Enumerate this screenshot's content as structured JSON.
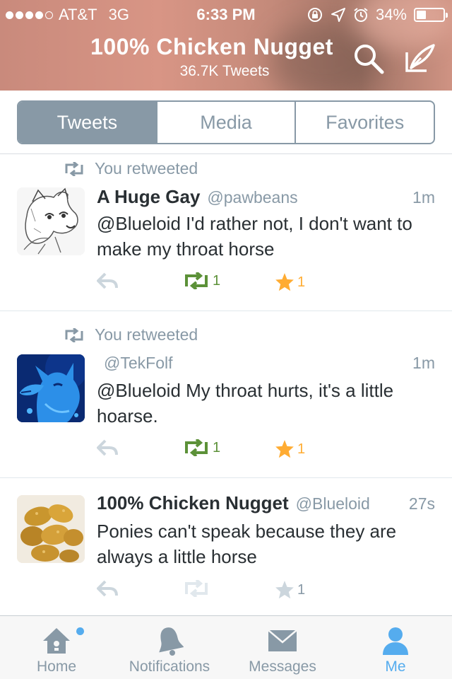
{
  "status_bar": {
    "carrier": "AT&T",
    "network": "3G",
    "time": "6:33 PM",
    "battery": "34%",
    "battery_level": 0.34
  },
  "header": {
    "title": "100% Chicken Nugget",
    "subtitle": "36.7K Tweets"
  },
  "tabs": [
    {
      "label": "Tweets",
      "active": true
    },
    {
      "label": "Media",
      "active": false
    },
    {
      "label": "Favorites",
      "active": false
    }
  ],
  "tweets": [
    {
      "retweet_label": "You retweeted",
      "name": "A Huge Gay",
      "handle": "@pawbeans",
      "time": "1m",
      "text": "@Blueloid I'd rather not, I don't want to make my throat horse",
      "retweets": "1",
      "favorites": "1"
    },
    {
      "retweet_label": "You retweeted",
      "name": "",
      "handle": "@TekFolf",
      "time": "1m",
      "text": "@Blueloid My throat hurts, it's a little hoarse.",
      "retweets": "1",
      "favorites": "1"
    },
    {
      "name": "100% Chicken Nugget",
      "handle": "@Blueloid",
      "time": "27s",
      "text": "Ponies can't speak because they are always a little horse",
      "retweets": "",
      "favorites": "1"
    }
  ],
  "tabbar": [
    {
      "label": "Home",
      "icon": "home-icon"
    },
    {
      "label": "Notifications",
      "icon": "bell-icon"
    },
    {
      "label": "Messages",
      "icon": "envelope-icon"
    },
    {
      "label": "Me",
      "icon": "person-icon",
      "active": true
    }
  ],
  "colors": {
    "accent": "#55acee",
    "retweet": "#5c9138",
    "favorite": "#ffac33",
    "muted": "#8899a6"
  }
}
